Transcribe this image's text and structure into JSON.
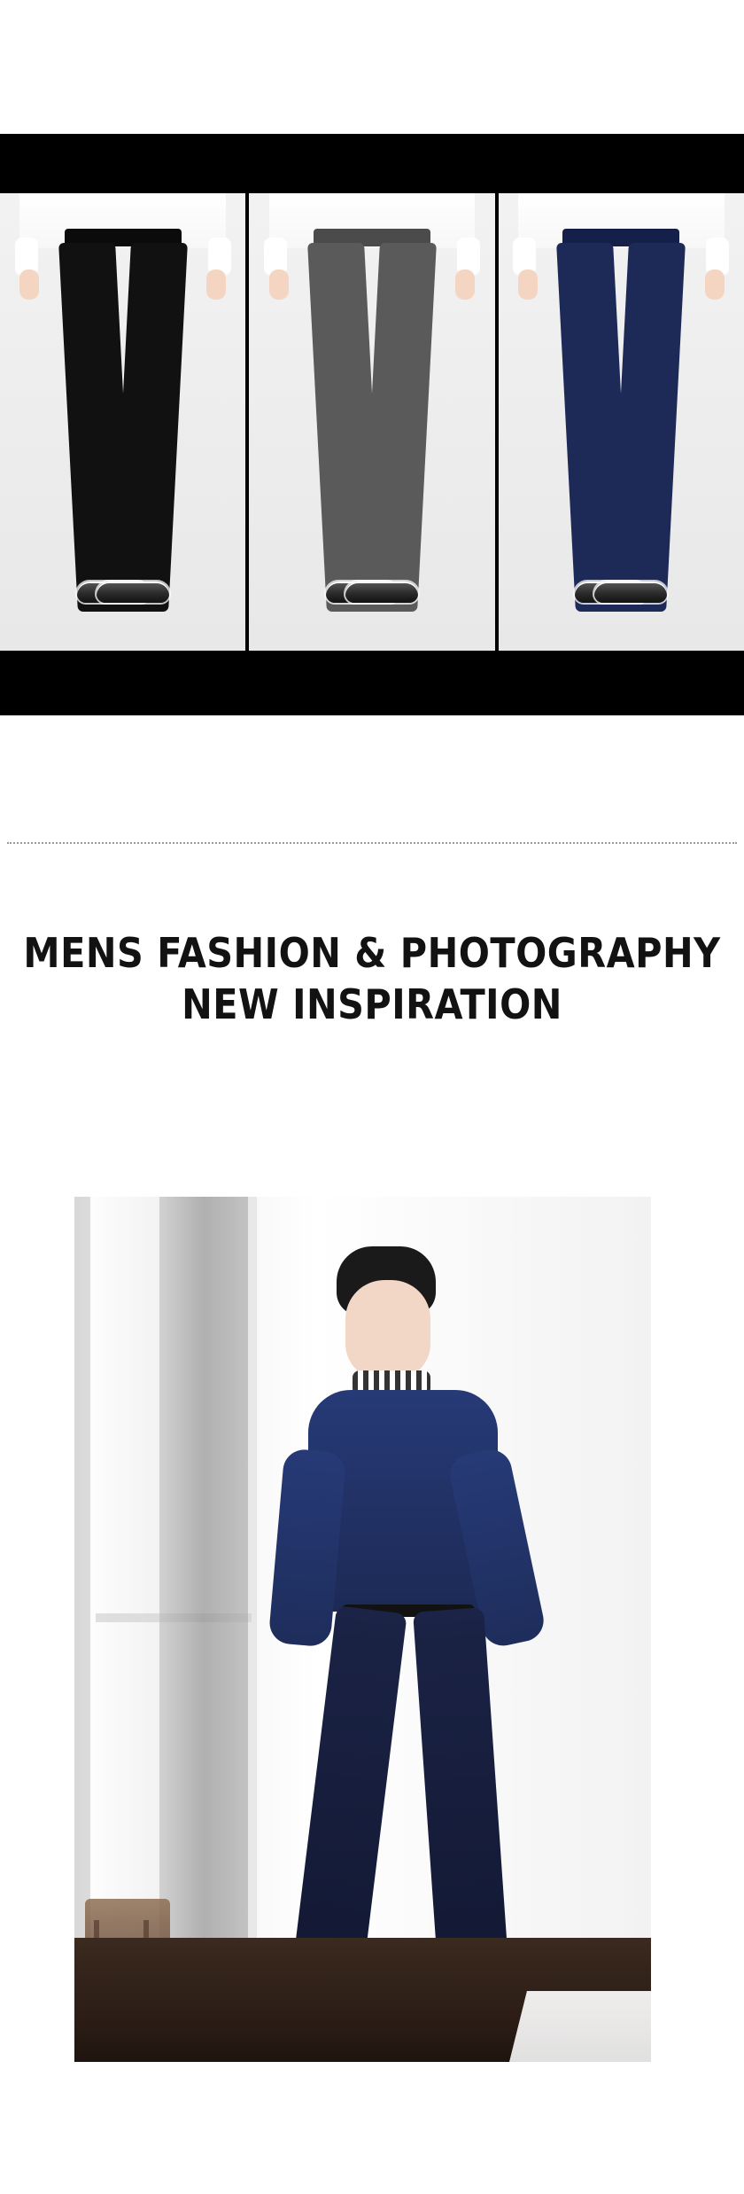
{
  "products": [
    {
      "id": "black",
      "colors": {
        "pants": "#111111",
        "waistband": "#0b0b0b"
      }
    },
    {
      "id": "gray",
      "colors": {
        "pants": "#5a5a5a",
        "waistband": "#4b4b4b"
      }
    },
    {
      "id": "navy",
      "colors": {
        "pants": "#1d2a57",
        "waistband": "#15204a"
      }
    }
  ],
  "headline": {
    "line1": "MENS FASHION & PHOTOGRAPHY",
    "line2": "NEW INSPIRATION"
  },
  "colors": {
    "band": "#000000",
    "text": "#121212",
    "divider": "#9a9a9a"
  }
}
